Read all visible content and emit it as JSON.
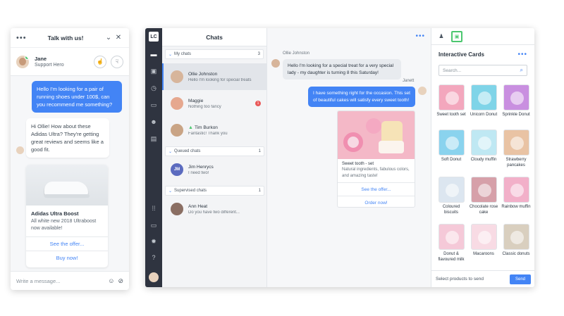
{
  "widget": {
    "header": {
      "menu_icon": "•••",
      "title": "Talk with us!",
      "minimize_icon": "⌄",
      "close_icon": "✕"
    },
    "agent": {
      "name": "Jane",
      "role": "Support Hero",
      "thumbs_up_icon": "☝",
      "thumbs_down_icon": "☟"
    },
    "messages": {
      "visitor": "Hello I'm looking for a pair of running shoes under 100$, can you recommend me something?",
      "agent": "Hi Ollie! How about these Adidas Ultra? They're getting great reviews and seems like a good fit."
    },
    "product_card": {
      "title": "Adidas Ultra Boost",
      "description": "All white new 2018 Ultraboost now available!",
      "button1": "See the offer...",
      "button2": "Buy now!"
    },
    "input": {
      "placeholder": "Write a message...",
      "emoji_icon": "☺",
      "attach_icon": "⊘"
    }
  },
  "app": {
    "logo": "LC",
    "rail_icons": [
      "chats-icon",
      "contacts-icon",
      "history-icon",
      "tickets-icon",
      "team-icon",
      "reports-icon",
      "apps-icon",
      "billing-icon",
      "settings-icon",
      "help-icon"
    ],
    "chat_list": {
      "title": "Chats",
      "sections": {
        "my_chats": {
          "label": "My chats",
          "count": "3"
        },
        "queued": {
          "label": "Queued chats",
          "count": "1"
        },
        "supervised": {
          "label": "Supervised chats",
          "count": "1"
        }
      },
      "chats": [
        {
          "name": "Ollie Johnston",
          "msg": "Hello I'm looking for special treats"
        },
        {
          "name": "Maggie",
          "msg": "Nothing too fancy",
          "badge": "1"
        },
        {
          "name": "Tim Burkon",
          "msg": "Fantastic! Thank you"
        },
        {
          "name": "Jim Henrycs",
          "msg": "I need two!",
          "initials": "JM"
        },
        {
          "name": "Ann Heat",
          "msg": "Do you have two different..."
        }
      ]
    },
    "conversation": {
      "menu_icon": "•••",
      "sender1": "Ollie Johnston",
      "msg1": "Hello I'm looking for a special treat for a very special lady - my daughter is turning 8 this Saturday!",
      "sender2": "Janett",
      "msg2": "I have something right for the occasion. This set of beautiful cakes will satisfy every sweet tooth!",
      "card": {
        "title": "Sweet tooth - set",
        "description": "Natural ingredients, fabulous colors, and amazing taste!",
        "button1": "See the offer...",
        "button2": "Order now!"
      }
    },
    "cards_panel": {
      "title": "Interactive Cards",
      "menu_icon": "•••",
      "search_placeholder": "Search...",
      "products": [
        {
          "label": "Sweet tooth set",
          "color": "#f3a7bd"
        },
        {
          "label": "Unicorn Donut",
          "color": "#7fd4e8"
        },
        {
          "label": "Sprinkle Donut",
          "color": "#c98fe0"
        },
        {
          "label": "Soft Donut",
          "color": "#8ad3ee"
        },
        {
          "label": "Cloudy muffin",
          "color": "#bfe8f3"
        },
        {
          "label": "Strawberry pancakes",
          "color": "#e9c3a4"
        },
        {
          "label": "Coloured biscuits",
          "color": "#dce6f0"
        },
        {
          "label": "Chocolate rose cake",
          "color": "#d6a0a9"
        },
        {
          "label": "Rainbow muffin",
          "color": "#f2b0c9"
        },
        {
          "label": "Donut & flavoured milk",
          "color": "#f5c9d8"
        },
        {
          "label": "Macaroons",
          "color": "#f8dbe4"
        },
        {
          "label": "Classic donuts",
          "color": "#d9cfbf"
        }
      ],
      "footer_text": "Select products to send",
      "send_label": "Send"
    }
  }
}
